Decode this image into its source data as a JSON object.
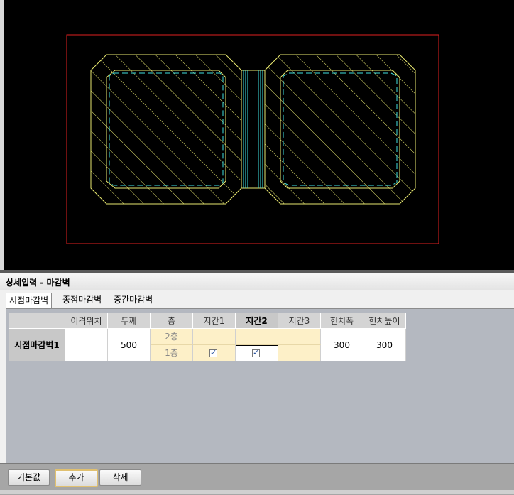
{
  "panel": {
    "title": "상세입력 - 마감벽"
  },
  "tabs": [
    {
      "label": "시점마감벽",
      "active": true
    },
    {
      "label": "종점마감벽",
      "active": false
    },
    {
      "label": "중간마감벽",
      "active": false
    }
  ],
  "table": {
    "headers": [
      "이격위치",
      "두께",
      "층",
      "지간1",
      "지간2",
      "지간3",
      "헌치폭",
      "헌치높이"
    ],
    "row_label": "시점마감벽1",
    "thickness": "500",
    "floors": [
      "2층",
      "1층"
    ],
    "haunch_width": "300",
    "haunch_height": "300",
    "offset_checked": false,
    "span1_1f_checked": true,
    "span2_1f_checked": true
  },
  "buttons": {
    "default": "기본값",
    "add": "추가",
    "delete": "삭제"
  },
  "colors": {
    "outline": "#e8e870",
    "inner": "#40e0e0",
    "boundary": "#e02020",
    "bg": "#000000"
  }
}
